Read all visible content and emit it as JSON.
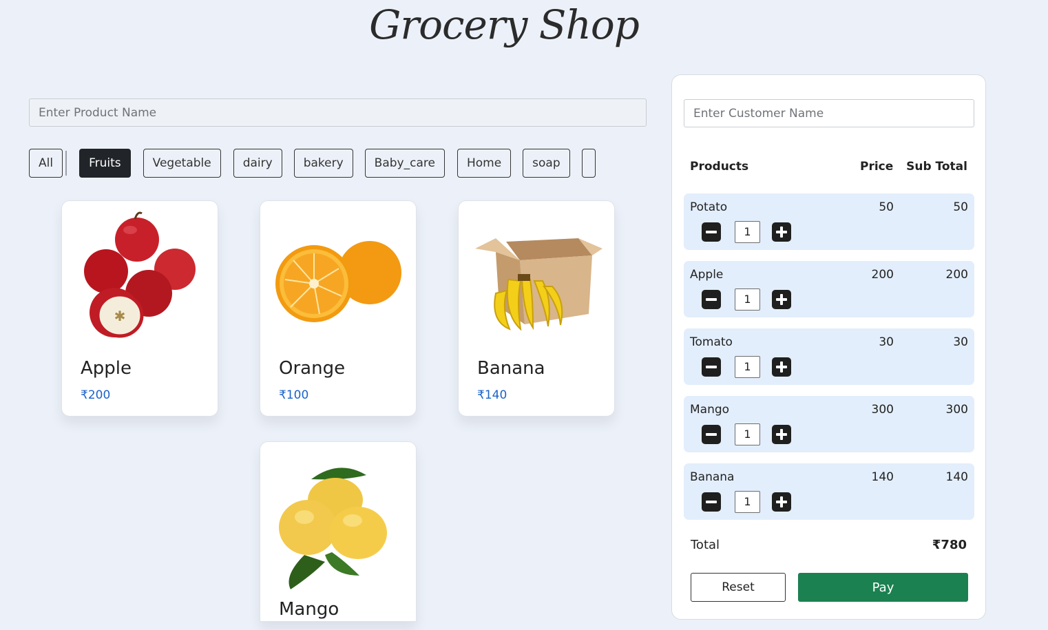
{
  "header": {
    "title": "Grocery Shop"
  },
  "search": {
    "placeholder": "Enter Product Name"
  },
  "categories": {
    "all_label": "All",
    "items": [
      "Fruits",
      "Vegetable",
      "dairy",
      "bakery",
      "Baby_care",
      "Home",
      "soap"
    ],
    "active": "Fruits"
  },
  "products": [
    {
      "name": "Apple",
      "price": "₹200",
      "icon": "apple-image"
    },
    {
      "name": "Orange",
      "price": "₹100",
      "icon": "orange-image"
    },
    {
      "name": "Banana",
      "price": "₹140",
      "icon": "banana-box-image"
    },
    {
      "name": "Mango",
      "price": "",
      "icon": "mango-image"
    }
  ],
  "cart": {
    "customer_placeholder": "Enter Customer Name",
    "headers": {
      "products": "Products",
      "price": "Price",
      "subtotal": "Sub Total"
    },
    "items": [
      {
        "name": "Potato",
        "price": "50",
        "subtotal": "50",
        "qty": "1"
      },
      {
        "name": "Apple",
        "price": "200",
        "subtotal": "200",
        "qty": "1"
      },
      {
        "name": "Tomato",
        "price": "30",
        "subtotal": "30",
        "qty": "1"
      },
      {
        "name": "Mango",
        "price": "300",
        "subtotal": "300",
        "qty": "1"
      },
      {
        "name": "Banana",
        "price": "140",
        "subtotal": "140",
        "qty": "1"
      }
    ],
    "total_label": "Total",
    "total_value": "₹780",
    "reset_label": "Reset",
    "pay_label": "Pay"
  },
  "colors": {
    "background": "#ecf1f9",
    "active_chip": "#212529",
    "price_blue": "#1a63c9",
    "cart_row": "#e3eefc",
    "pay_green": "#1c8151"
  }
}
